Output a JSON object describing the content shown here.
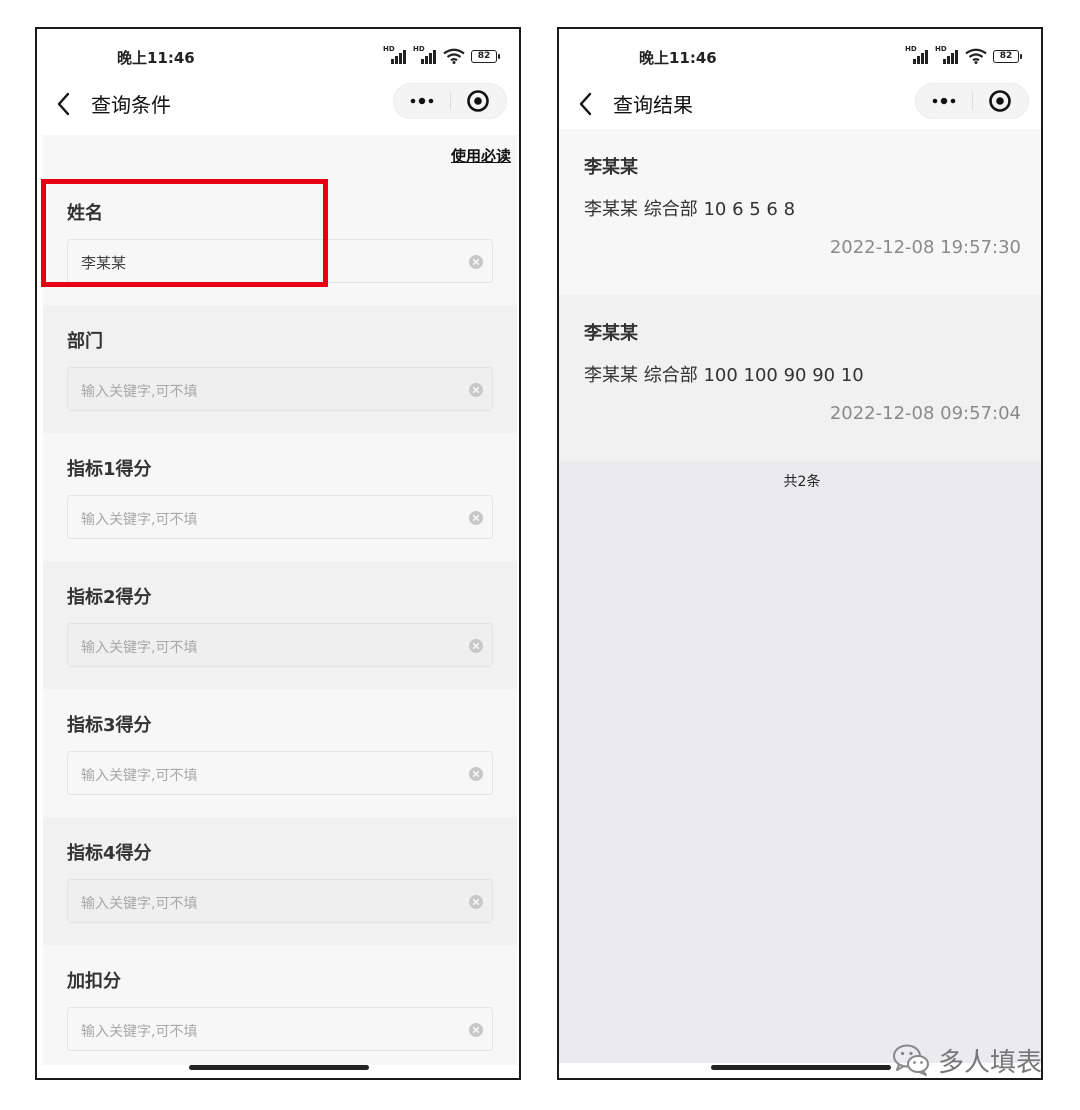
{
  "status_bar": {
    "time": "晚上11:46",
    "hd": "HD",
    "battery": "82"
  },
  "query_page": {
    "title": "查询条件",
    "notice_link": "使用必读",
    "fields": [
      {
        "label": "姓名",
        "value": "李某某",
        "placeholder": ""
      },
      {
        "label": "部门",
        "value": "",
        "placeholder": "输入关键字,可不填"
      },
      {
        "label": "指标1得分",
        "value": "",
        "placeholder": "输入关键字,可不填"
      },
      {
        "label": "指标2得分",
        "value": "",
        "placeholder": "输入关键字,可不填"
      },
      {
        "label": "指标3得分",
        "value": "",
        "placeholder": "输入关键字,可不填"
      },
      {
        "label": "指标4得分",
        "value": "",
        "placeholder": "输入关键字,可不填"
      },
      {
        "label": "加扣分",
        "value": "",
        "placeholder": "输入关键字,可不填"
      }
    ]
  },
  "result_page": {
    "title": "查询结果",
    "results": [
      {
        "name": "李某某",
        "detail": "李某某 综合部 10 6 5 6 8",
        "time": "2022-12-08 19:57:30"
      },
      {
        "name": "李某某",
        "detail": "李某某 综合部 100 100 90 90 10",
        "time": "2022-12-08 09:57:04"
      }
    ],
    "count_text": "共2条"
  },
  "watermark": {
    "text": "多人填表"
  },
  "colors": {
    "highlight": "#e60012"
  },
  "icons": [
    "back-icon",
    "more-icon",
    "target-icon",
    "clear-icon",
    "wifi-icon",
    "signal-icon",
    "battery-icon",
    "wechat-icon"
  ]
}
